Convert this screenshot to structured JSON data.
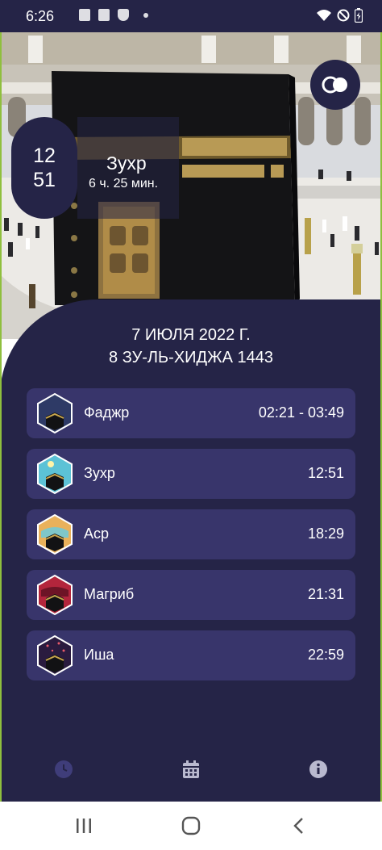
{
  "status_bar": {
    "time": "6:26",
    "left_icons": [
      "photo-icon",
      "clipboard-icon",
      "shield-icon",
      "dot-icon"
    ],
    "right_icons": [
      "wifi-icon",
      "do-not-disturb-icon",
      "battery-icon"
    ]
  },
  "current_prayer": {
    "hour": "12",
    "minute": "51",
    "name": "Зухр",
    "remaining": "6 ч. 25 мин."
  },
  "dates": {
    "gregorian": "7 ИЮЛЯ 2022 Г.",
    "hijri": "8 ЗУ-ЛЬ-ХИДЖА 1443"
  },
  "prayers": [
    {
      "name": "Фаджр",
      "time": "02:21 - 03:49",
      "icon": "night-kaaba-icon"
    },
    {
      "name": "Зухр",
      "time": "12:51",
      "icon": "noon-kaaba-icon"
    },
    {
      "name": "Аср",
      "time": "18:29",
      "icon": "afternoon-kaaba-icon"
    },
    {
      "name": "Магриб",
      "time": "21:31",
      "icon": "sunset-kaaba-icon"
    },
    {
      "name": "Иша",
      "time": "22:59",
      "icon": "starry-night-kaaba-icon"
    }
  ],
  "tabs": [
    {
      "icon": "clock-icon",
      "active": true
    },
    {
      "icon": "calendar-icon",
      "active": false
    },
    {
      "icon": "info-icon",
      "active": false
    }
  ],
  "colors": {
    "panel": "#252447",
    "row": "#38356b",
    "active_tab": "#3f3d7a",
    "inactive_tab": "#b9b9cf",
    "accent_edge": "#8fbf3e"
  }
}
